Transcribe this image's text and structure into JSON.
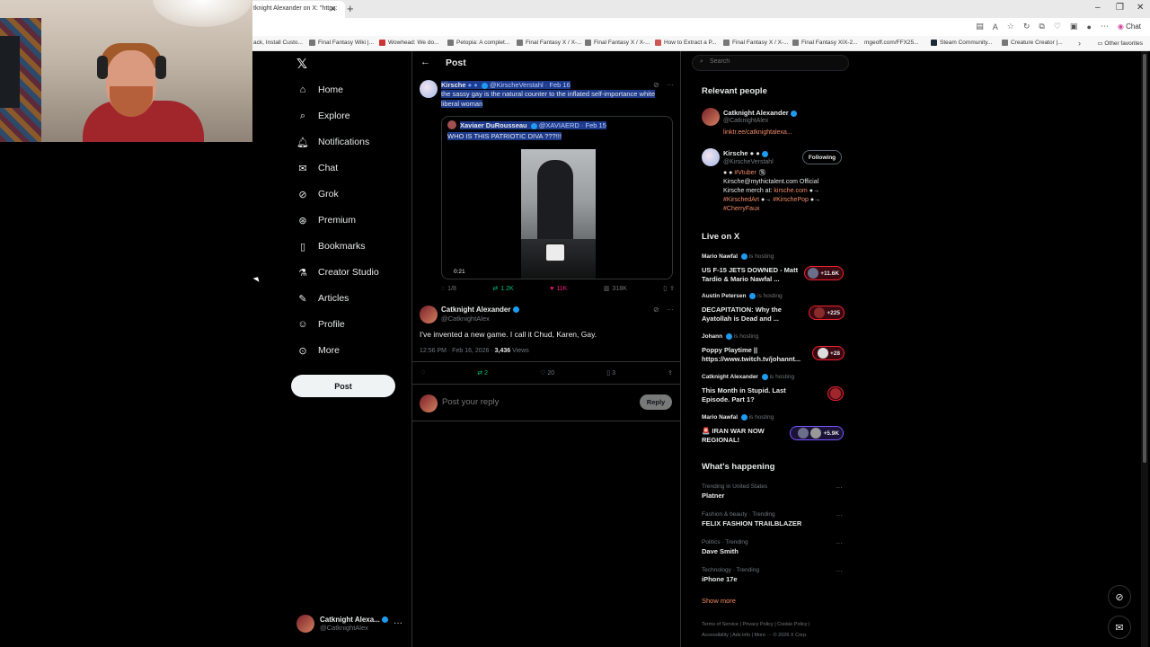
{
  "browser": {
    "active_tab_title": "tknight Alexander on X: \"https:",
    "bookmarks": [
      "ack, Install Custo...",
      "Final Fantasy Wiki |...",
      "Wowhead: We do...",
      "Petopia: A complet...",
      "Final Fantasy X / X-...",
      "Final Fantasy X / X-...",
      "How to Extract a P...",
      "Final Fantasy X / X-...",
      "Final Fantasy XIX-2...",
      "mgeoff.com/FFX25...",
      "Steam Community...",
      "Creature Creator |..."
    ],
    "other_favorites": "Other favorites",
    "chat_label": "Chat"
  },
  "nav": {
    "items": [
      {
        "label": "Home",
        "icon": "home-icon"
      },
      {
        "label": "Explore",
        "icon": "search-icon"
      },
      {
        "label": "Notifications",
        "icon": "bell-icon"
      },
      {
        "label": "Chat",
        "icon": "mail-icon"
      },
      {
        "label": "Grok",
        "icon": "grok-icon"
      },
      {
        "label": "Premium",
        "icon": "premium-icon"
      },
      {
        "label": "Bookmarks",
        "icon": "bookmark-icon"
      },
      {
        "label": "Creator Studio",
        "icon": "flask-icon"
      },
      {
        "label": "Articles",
        "icon": "article-icon"
      },
      {
        "label": "Profile",
        "icon": "person-icon"
      },
      {
        "label": "More",
        "icon": "more-icon"
      }
    ],
    "post_button": "Post",
    "account": {
      "name": "Catknight Alexa...",
      "handle": "@CatknightAlex"
    }
  },
  "post": {
    "header_title": "Post",
    "parent": {
      "name": "Kirsche",
      "handle": "@KirscheVerstahl",
      "date": "· Feb 16",
      "text": "the sassy gay is the natural counter to the inflated self-importance white liberal woman",
      "quote": {
        "name": "Xaviaer DuRousseau",
        "handle": "@XAVIAERD",
        "date": "· Feb 15",
        "text": "WHO IS THIS PATRIOTIC DIVA ???!!!",
        "video_time": "0:21"
      },
      "stats": {
        "replies": "1/8",
        "reposts": "1.2K",
        "likes": "11K",
        "views": "318K"
      }
    },
    "main": {
      "name": "Catknight Alexander",
      "handle": "@CatknightAlex",
      "text": "I've invented a new game. I call it Chud, Karen, Gay.",
      "time": "12:56 PM · Feb 16, 2026 · ",
      "views_count": "3,436",
      "views_label": "Views",
      "stats": {
        "reposts": "2",
        "likes": "20",
        "bookmarks": "3"
      }
    },
    "reply": {
      "placeholder": "Post your reply",
      "button": "Reply"
    }
  },
  "right": {
    "search_placeholder": "Search",
    "relevant_title": "Relevant people",
    "people": [
      {
        "name": "Catknight Alexander",
        "handle": "@CatknightAlex",
        "link": "linktr.ee/catknightalexa..."
      },
      {
        "name": "Kirsche",
        "handle": "@KirscheVerstahl",
        "follow": "Following",
        "bio_tag1": "#Vtuber",
        "bio_line2": "Kirsche@mythictalent.com Official",
        "bio_line3a": "Kirsche merch at: ",
        "bio_line3b": "kirsche.com",
        "bio_tag2": "#KirschedArt",
        "bio_tag3": "#KirschePop",
        "bio_tag4": "#CherryFaux"
      }
    ],
    "live_title": "Live on X",
    "live": [
      {
        "host": "Mario Nawfal",
        "status": "is hosting",
        "title": "US F-15 JETS DOWNED - Matt Tardio & Mario Nawfal ...",
        "count": "+11.6K"
      },
      {
        "host": "Austin Petersen",
        "status": "is hosting",
        "title": "DECAPITATION: Why the Ayatollah is Dead and ...",
        "count": "+225"
      },
      {
        "host": "Johann",
        "status": "is hosting",
        "title": "Poppy Playtime || https://www.twitch.tv/johannt...",
        "count": "+28"
      },
      {
        "host": "Catknight Alexander",
        "status": "is hosting",
        "title": "This Month in Stupid. Last Episode. Part 1?",
        "count": ""
      },
      {
        "host": "Mario Nawfal",
        "status": "is hosting",
        "title": "🚨 IRAN WAR NOW REGIONAL!",
        "count": "+5.9K"
      }
    ],
    "happening_title": "What's happening",
    "trends": [
      {
        "context": "Trending in United States",
        "name": "Platner"
      },
      {
        "context": "Fashion & beauty · Trending",
        "name": "FELIX FASHION TRAILBLAZER"
      },
      {
        "context": "Politics · Trending",
        "name": "Dave Smith"
      },
      {
        "context": "Technology · Trending",
        "name": "iPhone 17e"
      }
    ],
    "show_more": "Show more",
    "footer_line1": "Terms of Service  |  Privacy Policy  |  Cookie Policy  |",
    "footer_line2": "Accessibility  |  Ads info  |  More ···  © 2026 X Corp."
  }
}
